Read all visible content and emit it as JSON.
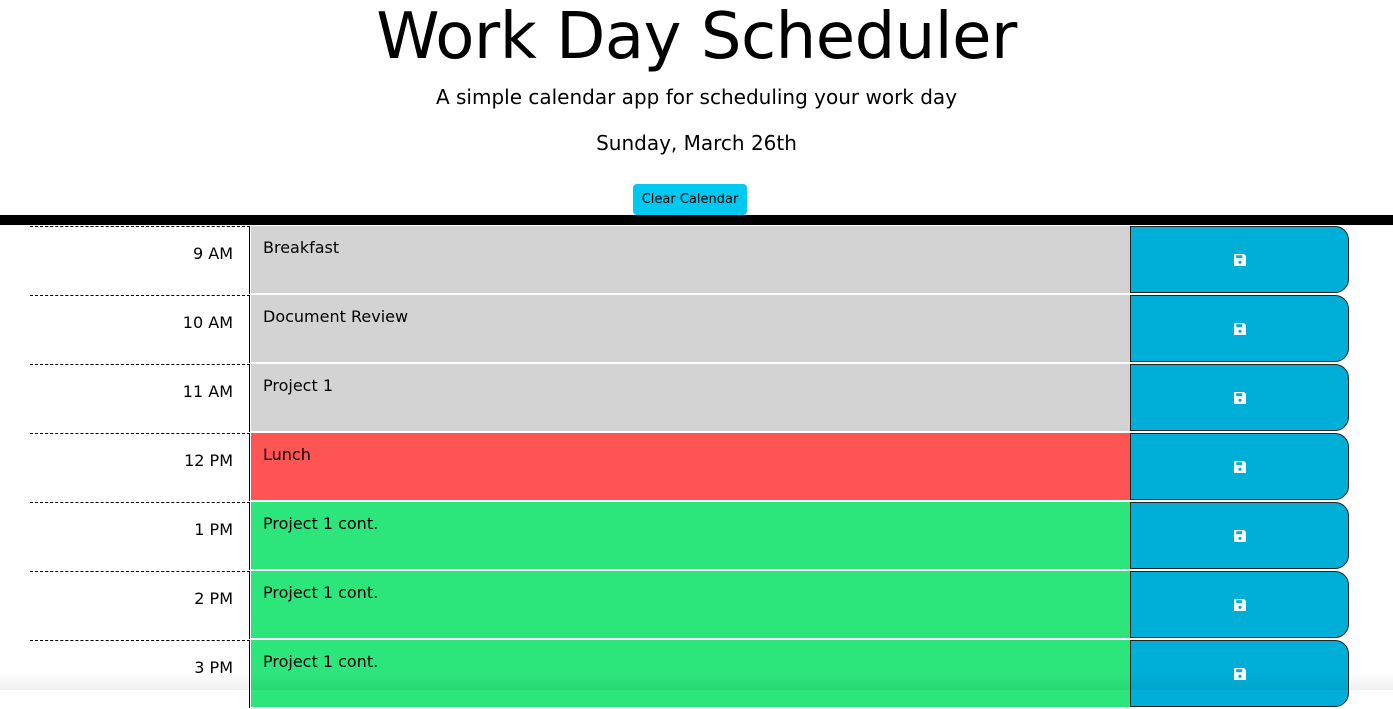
{
  "header": {
    "title": "Work Day Scheduler",
    "lead": "A simple calendar app for scheduling your work day",
    "current_day": "Sunday, March 26th",
    "clear_button_label": "Clear Calendar"
  },
  "colors": {
    "past": "#d3d3d3",
    "present": "#ff5454",
    "future": "#2ce67c",
    "save_button": "#00afd7",
    "clear_button": "#00c8f0"
  },
  "time_blocks": [
    {
      "hour": "9 AM",
      "text": "Breakfast",
      "state": "past",
      "save_icon": "floppy-disk-icon"
    },
    {
      "hour": "10 AM",
      "text": "Document Review",
      "state": "past",
      "save_icon": "floppy-disk-icon"
    },
    {
      "hour": "11 AM",
      "text": "Project 1",
      "state": "past",
      "save_icon": "floppy-disk-icon"
    },
    {
      "hour": "12 PM",
      "text": "Lunch",
      "state": "present",
      "save_icon": "floppy-disk-icon"
    },
    {
      "hour": "1 PM",
      "text": "Project 1 cont.",
      "state": "future",
      "save_icon": "floppy-disk-icon"
    },
    {
      "hour": "2 PM",
      "text": "Project 1 cont.",
      "state": "future",
      "save_icon": "floppy-disk-icon"
    },
    {
      "hour": "3 PM",
      "text": "Project 1 cont.",
      "state": "future",
      "save_icon": "floppy-disk-icon"
    }
  ]
}
